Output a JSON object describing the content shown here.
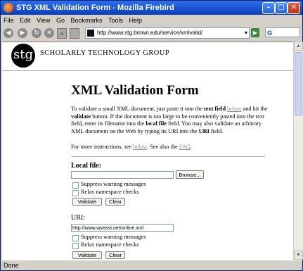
{
  "window": {
    "title": "STG XML Validation Form - Mozilla Firebird",
    "minimize_glyph": "–",
    "maximize_glyph": "□",
    "close_glyph": "✕"
  },
  "menu": [
    "File",
    "Edit",
    "View",
    "Go",
    "Bookmarks",
    "Tools",
    "Help"
  ],
  "nav": {
    "url": "http://www.stg.brown.edu/service/xmlvalid/",
    "search_text": "G",
    "go_glyph": "▶",
    "dropdown_glyph": "▾",
    "back_glyph": "◀",
    "forward_glyph": "▶",
    "reload_glyph": "↻",
    "stop_glyph": "✕",
    "home_glyph": "⌂",
    "icons": [
      "back-icon",
      "forward-icon",
      "reload-icon",
      "stop-icon",
      "home-icon",
      "print-icon"
    ]
  },
  "header": {
    "logo_text": "stg",
    "group_name": "SCHOLARLY TECHNOLOGY GROUP"
  },
  "page": {
    "title": "XML Validation Form",
    "intro": {
      "p1": "To validate a small XML document, just paste it into the ",
      "text_field": "text field",
      "p2": " ",
      "below1": "below",
      "p3": " and hit the ",
      "validate": "validate",
      "p4": " button. If the document is too large to be conveniently pasted into the text field, enter its filename into the ",
      "local_file": "local file",
      "p5": " field. You may also validate an arbitrary XML document on the Web by typing its URI into the ",
      "uri": "URI",
      "p6": " field."
    },
    "more": {
      "p1": "For more instructions, see ",
      "below2": "below",
      "p2": ". See also the ",
      "faq": "FAQ",
      "p3": "."
    }
  },
  "local_file_section": {
    "label": "Local file:",
    "value": "",
    "browse_label": "Browse...",
    "suppress_label": "Suppress warning messages",
    "relax_label": "Relax namespace checks",
    "validate_label": "Validate",
    "clear_label": "Clear"
  },
  "uri_section": {
    "label": "URI:",
    "value": "http://www.wyeast.net/online.xml",
    "suppress_label": "Suppress warning messages",
    "relax_label": "Relax namespace checks",
    "validate_label": "Validate",
    "clear_label": "Clear"
  },
  "status": {
    "text": "Done"
  }
}
